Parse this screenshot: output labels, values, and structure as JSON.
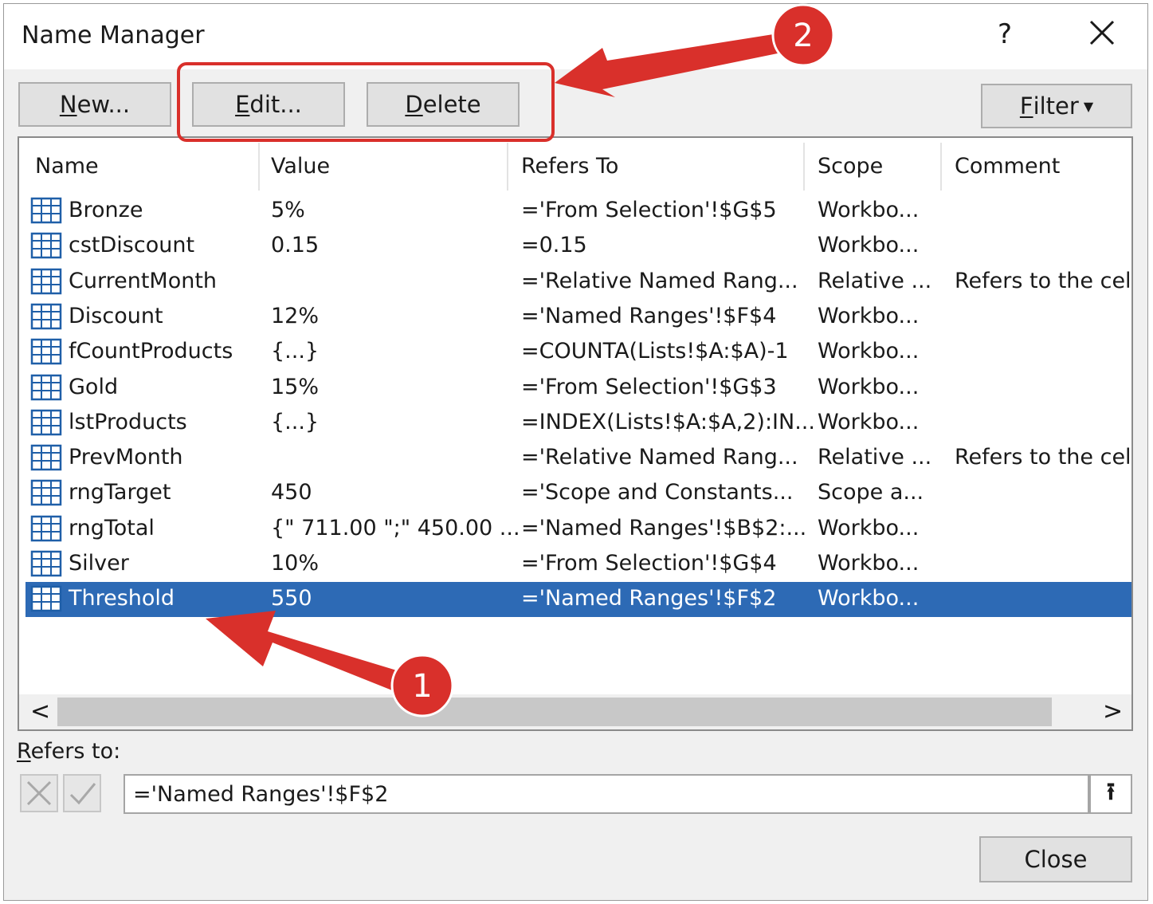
{
  "window": {
    "title": "Name Manager",
    "help_label": "?",
    "close_icon": "close-icon"
  },
  "toolbar": {
    "new_prefix": "N",
    "new_rest": "ew...",
    "edit_prefix": "E",
    "edit_rest": "dit...",
    "delete_prefix": "D",
    "delete_rest": "elete",
    "filter_prefix": "F",
    "filter_rest": "ilter"
  },
  "list": {
    "columns": [
      "Name",
      "Value",
      "Refers To",
      "Scope",
      "Comment"
    ],
    "rows": [
      {
        "name": "Bronze",
        "value": "5%",
        "refers": "='From Selection'!$G$5",
        "scope": "Workbo...",
        "comment": ""
      },
      {
        "name": "cstDiscount",
        "value": "0.15",
        "refers": "=0.15",
        "scope": "Workbo...",
        "comment": ""
      },
      {
        "name": "CurrentMonth",
        "value": "",
        "refers": "='Relative Named Rang...",
        "scope": "Relative ...",
        "comment": "Refers to the cell"
      },
      {
        "name": "Discount",
        "value": "12%",
        "refers": "='Named Ranges'!$F$4",
        "scope": "Workbo...",
        "comment": ""
      },
      {
        "name": "fCountProducts",
        "value": "{...}",
        "refers": "=COUNTA(Lists!$A:$A)-1",
        "scope": "Workbo...",
        "comment": ""
      },
      {
        "name": "Gold",
        "value": "15%",
        "refers": "='From Selection'!$G$3",
        "scope": "Workbo...",
        "comment": ""
      },
      {
        "name": "lstProducts",
        "value": "{...}",
        "refers": "=INDEX(Lists!$A:$A,2):IN...",
        "scope": "Workbo...",
        "comment": ""
      },
      {
        "name": "PrevMonth",
        "value": "",
        "refers": "='Relative Named Rang...",
        "scope": "Relative ...",
        "comment": "Refers to the cell"
      },
      {
        "name": "rngTarget",
        "value": "450",
        "refers": "='Scope and Constants...",
        "scope": "Scope a...",
        "comment": ""
      },
      {
        "name": "rngTotal",
        "value": "{\" 711.00 \";\" 450.00 ...",
        "refers": "='Named Ranges'!$B$2:...",
        "scope": "Workbo...",
        "comment": ""
      },
      {
        "name": "Silver",
        "value": "10%",
        "refers": "='From Selection'!$G$4",
        "scope": "Workbo...",
        "comment": ""
      },
      {
        "name": "Threshold",
        "value": "550",
        "refers": "='Named Ranges'!$F$2",
        "scope": "Workbo...",
        "comment": ""
      }
    ],
    "selected_index": 11
  },
  "scrollbar": {
    "left_icon": "<",
    "right_icon": ">"
  },
  "refers_to": {
    "label_prefix": "R",
    "label_rest": "efers to:",
    "value": "='Named Ranges'!$F$2",
    "collapse_icon": "⭱"
  },
  "footer": {
    "close_label": "Close"
  },
  "annotations": {
    "badge_1": "1",
    "badge_2": "2",
    "accent_color": "#d9302b"
  },
  "colors": {
    "selection": "#2d6ab5",
    "dialog_bg": "#f0f0f0"
  }
}
